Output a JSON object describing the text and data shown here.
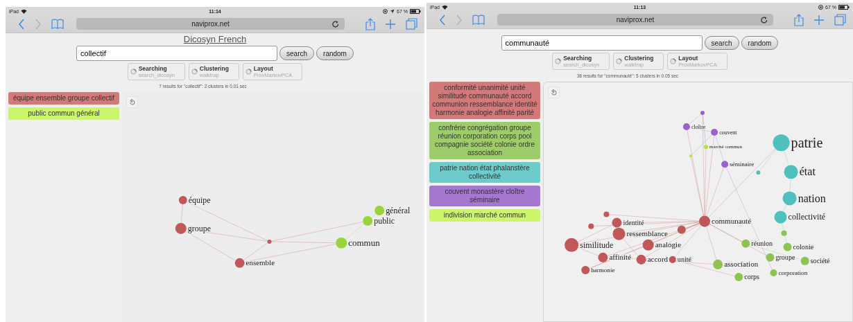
{
  "screens": [
    {
      "status_bar": {
        "device": "iPad",
        "time": "11:14",
        "battery": "67 %",
        "location": true
      },
      "toolbar": {
        "forward_disabled": true,
        "url": "naviprox.net"
      },
      "title": "Dicosyn French",
      "search": {
        "value": "collectif",
        "buttons": [
          "search",
          "random"
        ]
      },
      "options": [
        {
          "label": "Searching",
          "value": "search_dicosyn"
        },
        {
          "label": "Clustering",
          "value": "walktrap"
        },
        {
          "label": "Layout",
          "value": "ProxMarkovPCA"
        }
      ],
      "results": "7 results for \"collectif\": 2 clusters in 0.01 sec",
      "clusters": [
        {
          "words": "équipe ensemble groupe collectif",
          "color": "#d4787a"
        },
        {
          "words": "public commun général",
          "color": "#ccf56c"
        }
      ],
      "graph_nodes": [
        {
          "label": "équipe",
          "color": "#c0585a"
        },
        {
          "label": "groupe",
          "color": "#c0585a"
        },
        {
          "label": "ensemble",
          "color": "#c0585a"
        },
        {
          "color": "#c0585a"
        },
        {
          "label": "commun",
          "color": "#9ad43c"
        },
        {
          "label": "public",
          "color": "#9ad43c"
        },
        {
          "label": "général",
          "color": "#9ad43c"
        }
      ]
    },
    {
      "status_bar": {
        "device": "iPad",
        "time": "11:13",
        "battery": "67 %"
      },
      "toolbar": {
        "forward_disabled": true,
        "url": "naviprox.net"
      },
      "search": {
        "value": "communauté",
        "buttons": [
          "search",
          "random"
        ]
      },
      "options": [
        {
          "label": "Searching",
          "value": "search_dicosyn"
        },
        {
          "label": "Clustering",
          "value": "walktrap"
        },
        {
          "label": "Layout",
          "value": "ProxMarkovPCA"
        }
      ],
      "results": "36 results for \"communauté\": 5 clusters in 0.05 sec",
      "clusters": [
        {
          "words": "conformité unanimité unité similitude communauté accord communion ressemblance identité harmonie analogie affinité parité",
          "color": "#d4787a"
        },
        {
          "words": "confrérie congrégation groupe réunion corporation corps pool compagnie société colonie ordre association",
          "color": "#9fcc6b"
        },
        {
          "words": "patrie nation état phalanstère collectivité",
          "color": "#6ccbcb"
        },
        {
          "words": "couvent monastère cloître séminaire",
          "color": "#a477d0"
        },
        {
          "words": "indivision marché commun",
          "color": "#cdf56c"
        }
      ],
      "graph_nodes": [
        {
          "label": "communauté",
          "color": "#c0585a"
        },
        {
          "label": "identité",
          "color": "#c0585a"
        },
        {
          "label": "similitude",
          "color": "#c0585a"
        },
        {
          "label": "ressemblance",
          "color": "#c0585a"
        },
        {
          "label": "analogie",
          "color": "#c0585a"
        },
        {
          "label": "affinité",
          "color": "#c0585a"
        },
        {
          "label": "accord",
          "color": "#c0585a"
        },
        {
          "label": "harmonie",
          "color": "#c0585a"
        },
        {
          "label": "unité",
          "color": "#c0585a"
        },
        {
          "color": "#c0585a"
        },
        {
          "color": "#c0585a"
        },
        {
          "color": "#c0585a"
        },
        {
          "color": "#8cc451"
        },
        {
          "label": "réunion",
          "color": "#8cc451"
        },
        {
          "label": "colonie",
          "color": "#8cc451"
        },
        {
          "label": "groupe",
          "color": "#8cc451"
        },
        {
          "label": "société",
          "color": "#8cc451"
        },
        {
          "label": "association",
          "color": "#8cc451"
        },
        {
          "label": "corporation",
          "color": "#8cc451"
        },
        {
          "label": "corps",
          "color": "#8cc451"
        },
        {
          "label": "patrie",
          "color": "#4fc0c0"
        },
        {
          "label": "état",
          "color": "#4fc0c0"
        },
        {
          "label": "nation",
          "color": "#4fc0c0"
        },
        {
          "label": "collectivité",
          "color": "#4fc0c0"
        },
        {
          "color": "#4fc0c0"
        },
        {
          "label": "séminaire",
          "color": "#9a62cc"
        },
        {
          "label": "couvent",
          "color": "#9a62cc"
        },
        {
          "label": "cloître",
          "color": "#9a62cc"
        },
        {
          "color": "#9a62cc"
        },
        {
          "label": "marché commun",
          "color": "#b4e040"
        },
        {
          "color": "#b4e040"
        }
      ]
    }
  ]
}
